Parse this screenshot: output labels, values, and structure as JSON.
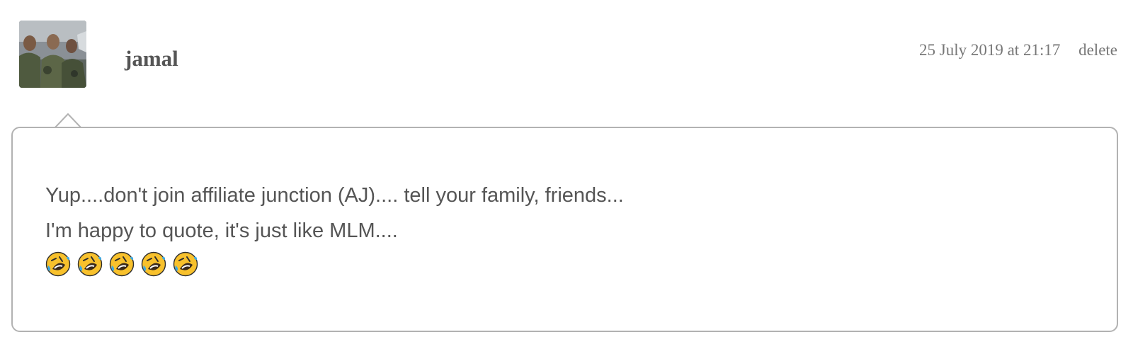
{
  "comment": {
    "author": "jamal",
    "timestamp": "25 July 2019 at 21:17",
    "delete_label": "delete",
    "body_lines": [
      "Yup....don't join affiliate junction (AJ).... tell your family, friends...",
      "I'm happy to quote, it's just like MLM...."
    ],
    "emoji_icons": [
      "rolling-on-floor-laughing-icon",
      "rolling-on-floor-laughing-icon",
      "rolling-on-floor-laughing-icon",
      "rolling-on-floor-laughing-icon",
      "rolling-on-floor-laughing-icon"
    ]
  },
  "colors": {
    "text": "#555555",
    "meta_text": "#777777",
    "bubble_border": "#b2b2b2",
    "emoji_face": "#f8c12c",
    "emoji_tear": "#3fa7e0"
  }
}
